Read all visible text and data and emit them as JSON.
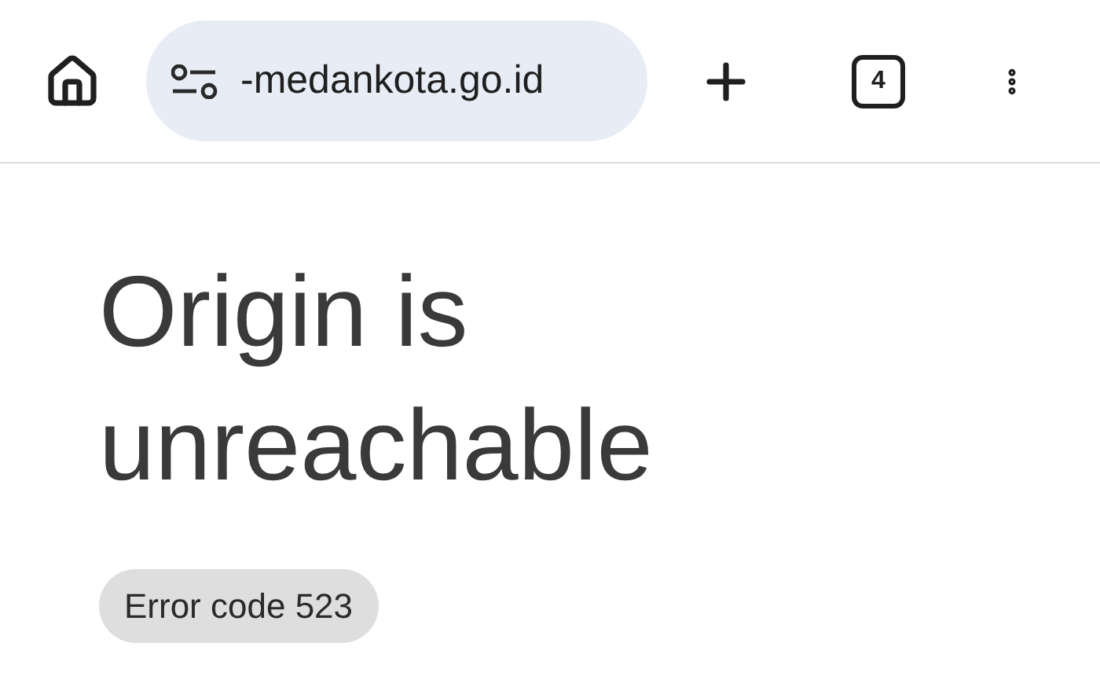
{
  "toolbar": {
    "url": "-medankota.go.id",
    "tab_count": "4"
  },
  "page": {
    "heading": "Origin is unreachable",
    "error_code": "Error code 523"
  }
}
